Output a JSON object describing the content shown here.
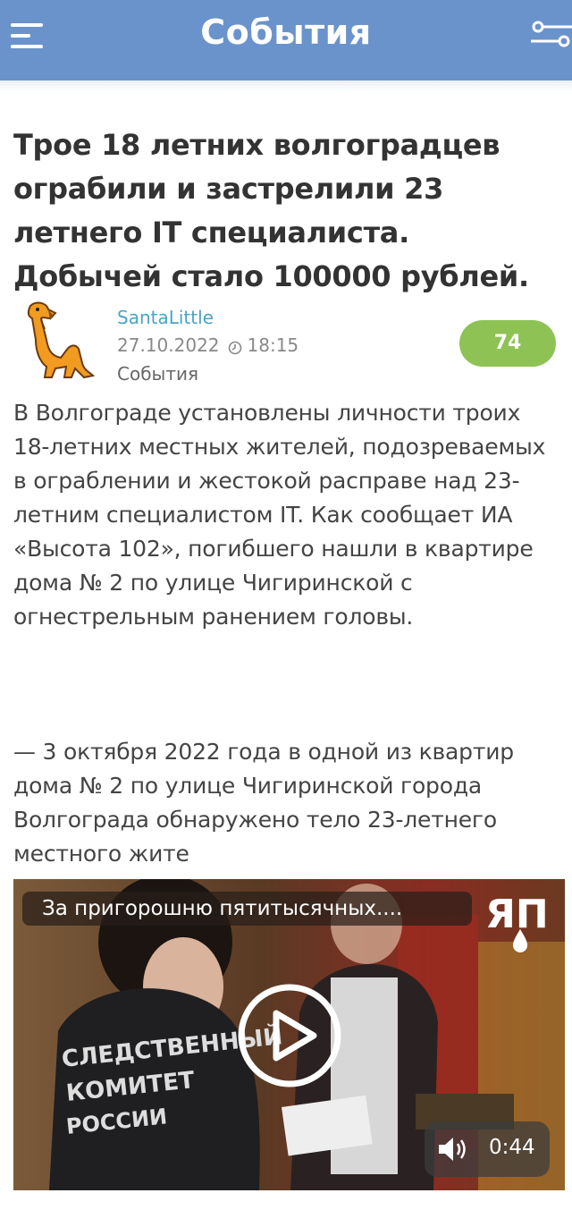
{
  "header": {
    "title": "События",
    "menu_icon": "hamburger-menu-icon",
    "filter_icon": "filter-sliders-icon"
  },
  "article": {
    "title": "Трое 18 летних волгоградцев ограбили и застрелили 23 летнего IT специалиста. Добычей стало 100000 рублей.",
    "author": "SantaLittle",
    "date": "27.10.2022",
    "time": "18:15",
    "category": "События",
    "rating": "74",
    "paragraph1": "В Волгограде установлены личности троих 18-летних местных жителей, подозреваемых в ограблении и жестокой расправе над 23-летним специалистом IT. Как сообщает ИА «Высота 102», погибшего нашли в квартире дома № 2 по улице Чигиринской с огнестрельным ранением головы.",
    "paragraph2": "— 3 октября 2022 года в одной из квартир дома № 2 по улице Чигиринской города Волгограда обнаружено тело 23-летнего местного жите"
  },
  "video": {
    "title": "За пригорошню пятитысячных....",
    "duration": "0:44",
    "vest_text": "СЛЕДСТВЕННЫЙ КОМИТЕТ РОССИИ",
    "logo_text": "ЯП",
    "play_icon": "play-icon",
    "volume_icon": "volume-icon"
  },
  "colors": {
    "header_bg": "#6b93cb",
    "accent_link": "#4aa3c7",
    "rating_bg": "#8ec255"
  }
}
